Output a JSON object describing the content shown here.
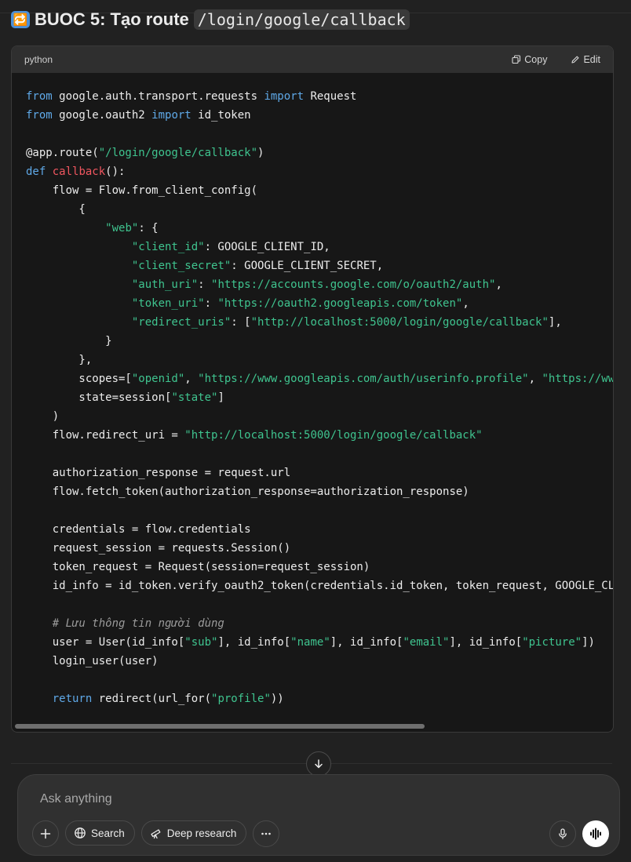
{
  "heading": {
    "emoji": "🔁",
    "text": "BUOC 5: Tạo route",
    "code": "/login/google/callback"
  },
  "codeblock": {
    "language": "python",
    "copy_label": "Copy",
    "edit_label": "Edit",
    "lines": [
      [
        [
          "kw",
          "from"
        ],
        [
          "t",
          " google.auth.transport.requests "
        ],
        [
          "kw",
          "import"
        ],
        [
          "t",
          " Request"
        ]
      ],
      [
        [
          "kw",
          "from"
        ],
        [
          "t",
          " google.oauth2 "
        ],
        [
          "kw",
          "import"
        ],
        [
          "t",
          " id_token"
        ]
      ],
      [],
      [
        [
          "t",
          "@app.route("
        ],
        [
          "str",
          "\"/login/google/callback\""
        ],
        [
          "t",
          ")"
        ]
      ],
      [
        [
          "kw",
          "def"
        ],
        [
          "t",
          " "
        ],
        [
          "fn",
          "callback"
        ],
        [
          "t",
          "():"
        ]
      ],
      [
        [
          "t",
          "    flow = Flow.from_client_config("
        ]
      ],
      [
        [
          "t",
          "        {"
        ]
      ],
      [
        [
          "t",
          "            "
        ],
        [
          "str",
          "\"web\""
        ],
        [
          "t",
          ": {"
        ]
      ],
      [
        [
          "t",
          "                "
        ],
        [
          "str",
          "\"client_id\""
        ],
        [
          "t",
          ": GOOGLE_CLIENT_ID,"
        ]
      ],
      [
        [
          "t",
          "                "
        ],
        [
          "str",
          "\"client_secret\""
        ],
        [
          "t",
          ": GOOGLE_CLIENT_SECRET,"
        ]
      ],
      [
        [
          "t",
          "                "
        ],
        [
          "str",
          "\"auth_uri\""
        ],
        [
          "t",
          ": "
        ],
        [
          "str",
          "\"https://accounts.google.com/o/oauth2/auth\""
        ],
        [
          "t",
          ","
        ]
      ],
      [
        [
          "t",
          "                "
        ],
        [
          "str",
          "\"token_uri\""
        ],
        [
          "t",
          ": "
        ],
        [
          "str",
          "\"https://oauth2.googleapis.com/token\""
        ],
        [
          "t",
          ","
        ]
      ],
      [
        [
          "t",
          "                "
        ],
        [
          "str",
          "\"redirect_uris\""
        ],
        [
          "t",
          ": ["
        ],
        [
          "str",
          "\"http://localhost:5000/login/google/callback\""
        ],
        [
          "t",
          "],"
        ]
      ],
      [
        [
          "t",
          "            }"
        ]
      ],
      [
        [
          "t",
          "        },"
        ]
      ],
      [
        [
          "t",
          "        scopes=["
        ],
        [
          "str",
          "\"openid\""
        ],
        [
          "t",
          ", "
        ],
        [
          "str",
          "\"https://www.googleapis.com/auth/userinfo.profile\""
        ],
        [
          "t",
          ", "
        ],
        [
          "str",
          "\"https://www"
        ]
      ],
      [
        [
          "t",
          "        state=session["
        ],
        [
          "str",
          "\"state\""
        ],
        [
          "t",
          "]"
        ]
      ],
      [
        [
          "t",
          "    )"
        ]
      ],
      [
        [
          "t",
          "    flow.redirect_uri = "
        ],
        [
          "str",
          "\"http://localhost:5000/login/google/callback\""
        ]
      ],
      [],
      [
        [
          "t",
          "    authorization_response = request.url"
        ]
      ],
      [
        [
          "t",
          "    flow.fetch_token(authorization_response=authorization_response)"
        ]
      ],
      [],
      [
        [
          "t",
          "    credentials = flow.credentials"
        ]
      ],
      [
        [
          "t",
          "    request_session = requests.Session()"
        ]
      ],
      [
        [
          "t",
          "    token_request = Request(session=request_session)"
        ]
      ],
      [
        [
          "t",
          "    id_info = id_token.verify_oauth2_token(credentials.id_token, token_request, GOOGLE_CL"
        ]
      ],
      [],
      [
        [
          "t",
          "    "
        ],
        [
          "cm",
          "# Lưu thông tin người dùng"
        ]
      ],
      [
        [
          "t",
          "    user = User(id_info["
        ],
        [
          "str",
          "\"sub\""
        ],
        [
          "t",
          "], id_info["
        ],
        [
          "str",
          "\"name\""
        ],
        [
          "t",
          "], id_info["
        ],
        [
          "str",
          "\"email\""
        ],
        [
          "t",
          "], id_info["
        ],
        [
          "str",
          "\"picture\""
        ],
        [
          "t",
          "])"
        ]
      ],
      [
        [
          "t",
          "    login_user(user)"
        ]
      ],
      [],
      [
        [
          "t",
          "    "
        ],
        [
          "kw",
          "return"
        ],
        [
          "t",
          " redirect(url_for("
        ],
        [
          "str",
          "\"profile\""
        ],
        [
          "t",
          "))"
        ]
      ]
    ]
  },
  "composer": {
    "placeholder": "Ask anything",
    "search_label": "Search",
    "deep_research_label": "Deep research"
  },
  "colors": {
    "background": "#212121",
    "keyword": "#5fa9e8",
    "string": "#3fc48f",
    "function": "#f0565f"
  }
}
